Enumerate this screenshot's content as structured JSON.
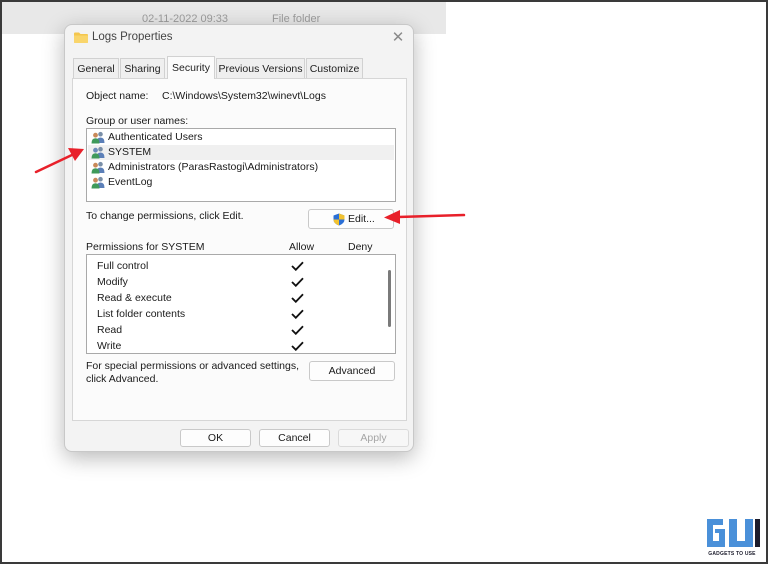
{
  "background_window": {
    "date_text": "02-11-2022 09:33",
    "type_text": "File folder"
  },
  "dialog": {
    "title": "Logs Properties",
    "title_icon": "folder-icon",
    "close_icon": "close-icon",
    "close_label": "✕"
  },
  "tabs": [
    {
      "label": "General"
    },
    {
      "label": "Sharing"
    },
    {
      "label": "Security"
    },
    {
      "label": "Previous Versions"
    },
    {
      "label": "Customize"
    }
  ],
  "active_tab": "Security",
  "security": {
    "object_name_label": "Object name:",
    "object_name_value": "C:\\Windows\\System32\\winevt\\Logs",
    "group_label": "Group or user names:",
    "groups": [
      {
        "name": "Authenticated Users",
        "icon": "user-group-icon",
        "selected": false
      },
      {
        "name": "SYSTEM",
        "icon": "user-group-icon",
        "selected": true
      },
      {
        "name": "Administrators (ParasRastogi\\Administrators)",
        "icon": "user-group-icon",
        "selected": false
      },
      {
        "name": "EventLog",
        "icon": "user-group-icon",
        "selected": false
      }
    ],
    "change_hint": "To change permissions, click Edit.",
    "edit_button": "Edit...",
    "edit_icon": "uac-shield-icon",
    "permissions_for": "Permissions for SYSTEM",
    "allow_header": "Allow",
    "deny_header": "Deny",
    "permissions": [
      {
        "name": "Full control",
        "allow": true,
        "deny": false
      },
      {
        "name": "Modify",
        "allow": true,
        "deny": false
      },
      {
        "name": "Read & execute",
        "allow": true,
        "deny": false
      },
      {
        "name": "List folder contents",
        "allow": true,
        "deny": false
      },
      {
        "name": "Read",
        "allow": true,
        "deny": false
      },
      {
        "name": "Write",
        "allow": true,
        "deny": false
      }
    ],
    "special_line1": "For special permissions or advanced settings,",
    "special_line2": "click Advanced.",
    "advanced_button": "Advanced"
  },
  "footer": {
    "ok": "OK",
    "cancel": "Cancel",
    "apply": "Apply",
    "apply_enabled": false
  },
  "annotations": {
    "arrow_color": "#e8202a",
    "targets": [
      "SYSTEM",
      "Edit..."
    ]
  },
  "watermark": {
    "logo_text": "GU",
    "tagline": "GADGETS TO USE",
    "color": "#4a90d9"
  },
  "colors": {
    "dialog_bg": "#f3f3f3",
    "panel_bg": "#fbfbfb",
    "selection_bg": "#f0f0f0",
    "folder_yellow": "#f4c64e",
    "shield_blue": "#2a6fd6",
    "shield_yellow": "#f2c230"
  }
}
